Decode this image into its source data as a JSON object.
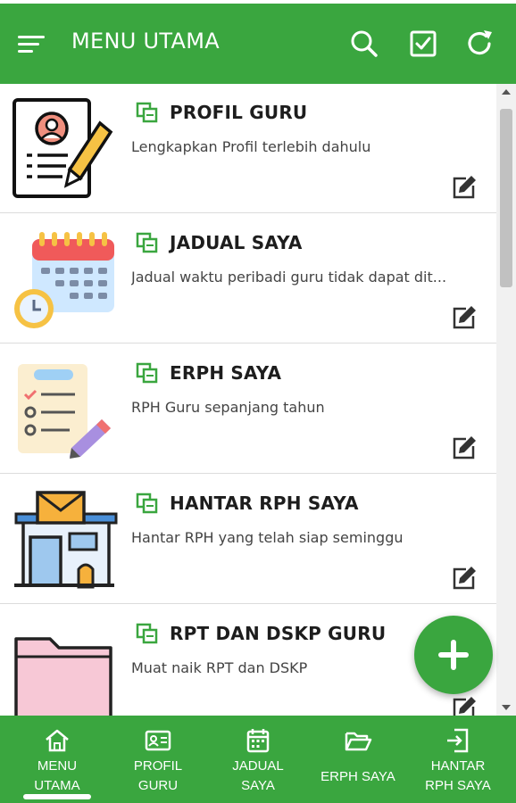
{
  "header": {
    "title": "MENU UTAMA",
    "icons": [
      "menu-icon",
      "search-icon",
      "checkbox-icon",
      "refresh-icon"
    ]
  },
  "cards": [
    {
      "title": "PROFIL GURU",
      "subtitle": "Lengkapkan Profil terlebih dahulu",
      "image": "teacher-profile-icon"
    },
    {
      "title": "JADUAL SAYA",
      "subtitle": "Jadual waktu peribadi guru tidak dapat dit...",
      "image": "calendar-clock-icon"
    },
    {
      "title": "ERPH SAYA",
      "subtitle": "RPH Guru sepanjang tahun",
      "image": "checklist-pencil-icon"
    },
    {
      "title": "HANTAR RPH SAYA",
      "subtitle": "Hantar RPH yang telah siap seminggu",
      "image": "post-office-icon"
    },
    {
      "title": "RPT DAN DSKP GURU",
      "subtitle": "Muat naik RPT dan DSKP",
      "image": "folder-icon"
    }
  ],
  "fab": {
    "icon": "plus-icon"
  },
  "bottom_nav": {
    "items": [
      {
        "label": "MENU\nUTAMA",
        "icon": "home-icon",
        "active": true
      },
      {
        "label": "PROFIL\nGURU",
        "icon": "id-card-icon",
        "active": false
      },
      {
        "label": "JADUAL\nSAYA",
        "icon": "calendar-icon",
        "active": false
      },
      {
        "label": "ERPH SAYA",
        "icon": "folder-open-icon",
        "active": false
      },
      {
        "label": "HANTAR\nRPH SAYA",
        "icon": "send-file-icon",
        "active": false
      }
    ]
  },
  "colors": {
    "primary": "#3aa63f",
    "text": "#1d1d1d",
    "subtext": "#444444"
  }
}
